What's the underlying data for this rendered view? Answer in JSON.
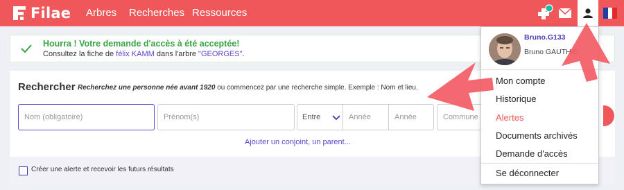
{
  "nav": {
    "logo_text": "Filae",
    "links": [
      "Arbres",
      "Recherches",
      "Ressources"
    ],
    "icons": [
      "tree-plus-icon",
      "mail-icon",
      "user-icon",
      "france-flag-icon"
    ],
    "colors": {
      "brand": "#f0575a",
      "accent": "#5a48c8",
      "success": "#3aa543",
      "badge": "#1abc9c"
    }
  },
  "banner": {
    "title": "Hourra ! Votre demande d'accès à été acceptée!",
    "line_prefix": "Consultez la fiche de ",
    "person_link": "félix KAMM",
    "line_middle": " dans l'arbre ",
    "tree_link": "\"GEORGES\"",
    "line_suffix": "."
  },
  "search": {
    "title": "Rechercher",
    "hint_bold": "Recherchez une personne née avant 1920",
    "hint_rest": " ou commencez par une recherche simple. Exemple : Nom et lieu.",
    "name_placeholder": "Nom (obligatoire)",
    "firstname_placeholder": "Prénom(s)",
    "range_select": "Entre",
    "year1_placeholder": "Année",
    "year2_placeholder": "Année",
    "commune_placeholder": "Commune o",
    "add_link": "Ajouter un conjoint, un parent...",
    "alert_checkbox_label": "Créer une alerte et recevoir les futurs résultats"
  },
  "user_menu": {
    "username": "Bruno.G133",
    "fullname": "Bruno GAUTHIE",
    "items": [
      "Mon compte",
      "Historique",
      "Alertes",
      "Documents archivés",
      "Demande d'accès",
      "Se déconnecter"
    ],
    "highlighted_item": "Alertes"
  }
}
